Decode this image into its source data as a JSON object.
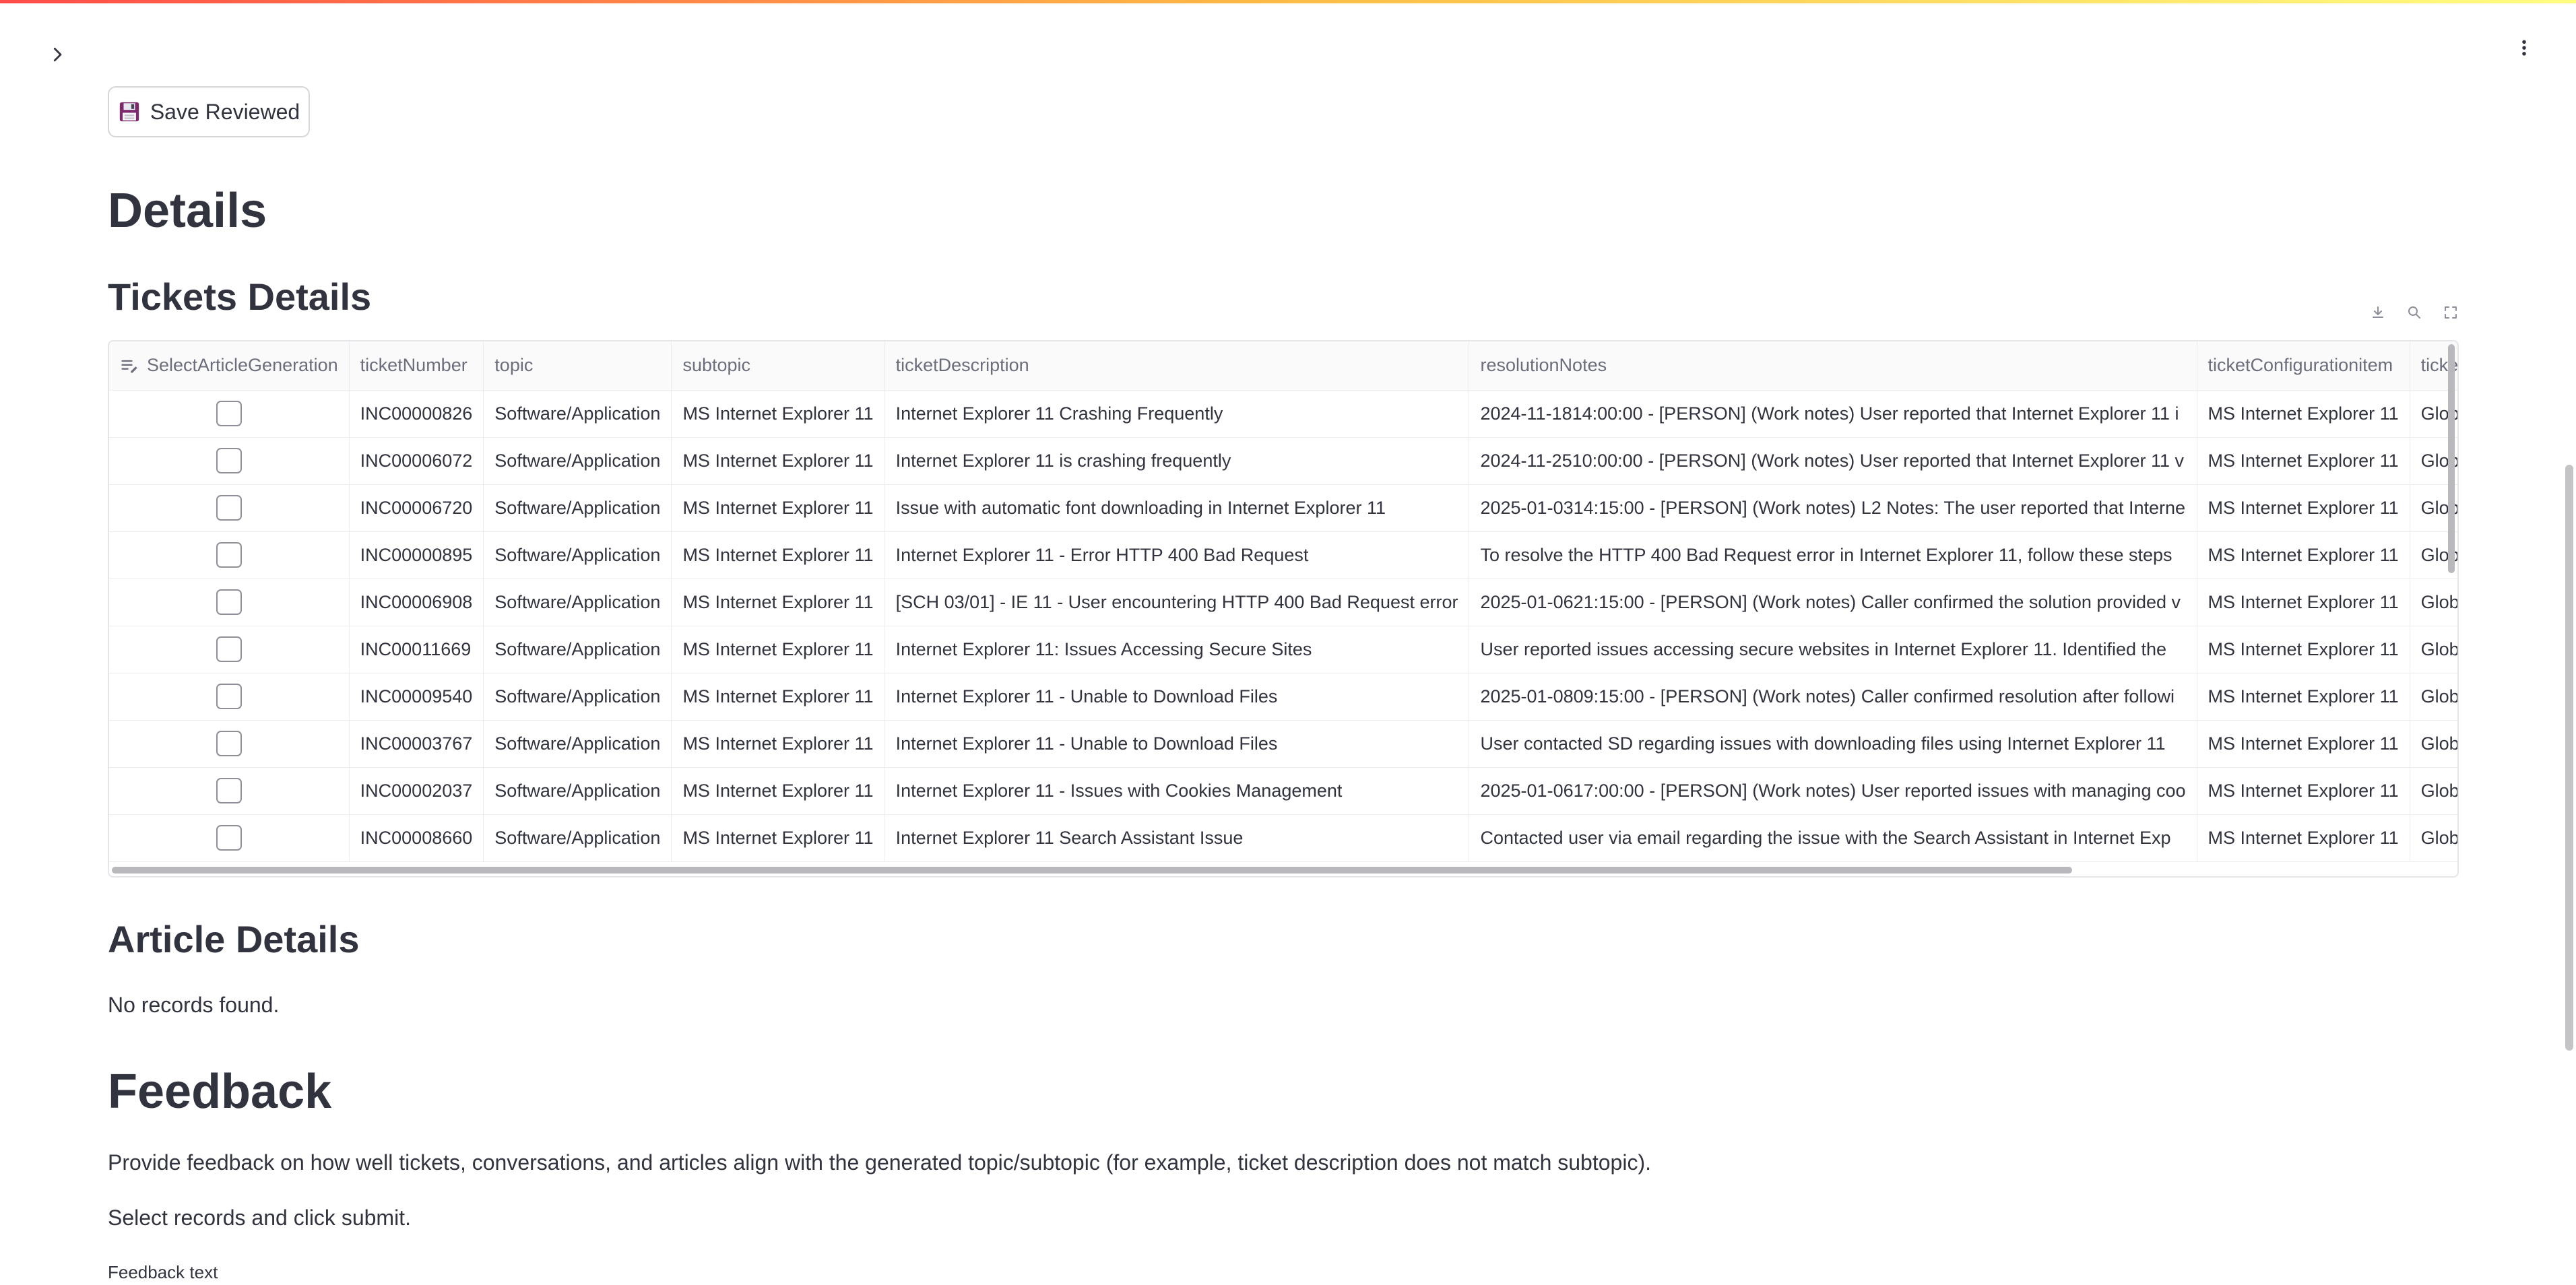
{
  "toolbar": {
    "save_label": "Save Reviewed"
  },
  "headings": {
    "details": "Details",
    "tickets_details": "Tickets Details",
    "article_details": "Article Details",
    "feedback": "Feedback"
  },
  "article": {
    "empty_message": "No records found."
  },
  "feedback": {
    "description": "Provide feedback on how well tickets, conversations, and articles align with the generated topic/subtopic (for example, ticket description does not match subtopic).",
    "instruction": "Select records and click submit.",
    "text_label": "Feedback text"
  },
  "grid": {
    "columns": [
      "SelectArticleGeneration",
      "ticketNumber",
      "topic",
      "subtopic",
      "ticketDescription",
      "resolutionNotes",
      "ticketConfigurationitem",
      "ticketAssignedTo"
    ],
    "rows": [
      {
        "selected": false,
        "ticketNumber": "INC00000826",
        "topic": "Software/Application",
        "subtopic": "MS Internet Explorer 11",
        "ticketDescription": "Internet Explorer 11 Crashing Frequently",
        "resolutionNotes": "2024-11-1814:00:00 - [PERSON] (Work notes) User reported that Internet Explorer 11 i",
        "ticketConfigurationitem": "MS Internet Explorer 11",
        "ticketAssignedTo": "Global.Propentia"
      },
      {
        "selected": false,
        "ticketNumber": "INC00006072",
        "topic": "Software/Application",
        "subtopic": "MS Internet Explorer 11",
        "ticketDescription": "Internet Explorer 11 is crashing frequently",
        "resolutionNotes": "2024-11-2510:00:00 - [PERSON] (Work notes) User reported that Internet Explorer 11 v",
        "ticketConfigurationitem": "MS Internet Explorer 11",
        "ticketAssignedTo": "Global.Propentia"
      },
      {
        "selected": false,
        "ticketNumber": "INC00006720",
        "topic": "Software/Application",
        "subtopic": "MS Internet Explorer 11",
        "ticketDescription": "Issue with automatic font downloading in Internet Explorer 11",
        "resolutionNotes": "2025-01-0314:15:00 - [PERSON] (Work notes) L2 Notes: The user reported that Interne",
        "ticketConfigurationitem": "MS Internet Explorer 11",
        "ticketAssignedTo": "Global.Propentia"
      },
      {
        "selected": false,
        "ticketNumber": "INC00000895",
        "topic": "Software/Application",
        "subtopic": "MS Internet Explorer 11",
        "ticketDescription": "Internet Explorer 11 - Error HTTP 400 Bad Request",
        "resolutionNotes": "To resolve the HTTP 400 Bad Request error in Internet Explorer 11, follow these steps",
        "ticketConfigurationitem": "MS Internet Explorer 11",
        "ticketAssignedTo": "Global.Propentia"
      },
      {
        "selected": false,
        "ticketNumber": "INC00006908",
        "topic": "Software/Application",
        "subtopic": "MS Internet Explorer 11",
        "ticketDescription": "[SCH 03/01] - IE 11 - User encountering HTTP 400 Bad Request error",
        "resolutionNotes": "2025-01-0621:15:00 - [PERSON] (Work notes) Caller confirmed the solution provided v",
        "ticketConfigurationitem": "MS Internet Explorer 11",
        "ticketAssignedTo": "Global.Propentia"
      },
      {
        "selected": false,
        "ticketNumber": "INC00011669",
        "topic": "Software/Application",
        "subtopic": "MS Internet Explorer 11",
        "ticketDescription": "Internet Explorer 11: Issues Accessing Secure Sites",
        "resolutionNotes": "User reported issues accessing secure websites in Internet Explorer 11. Identified the",
        "ticketConfigurationitem": "MS Internet Explorer 11",
        "ticketAssignedTo": "Global.Propentia"
      },
      {
        "selected": false,
        "ticketNumber": "INC00009540",
        "topic": "Software/Application",
        "subtopic": "MS Internet Explorer 11",
        "ticketDescription": "Internet Explorer 11 - Unable to Download Files",
        "resolutionNotes": "2025-01-0809:15:00 - [PERSON] (Work notes) Caller confirmed resolution after followi",
        "ticketConfigurationitem": "MS Internet Explorer 11",
        "ticketAssignedTo": "Global.Propentia"
      },
      {
        "selected": false,
        "ticketNumber": "INC00003767",
        "topic": "Software/Application",
        "subtopic": "MS Internet Explorer 11",
        "ticketDescription": "Internet Explorer 11 - Unable to Download Files",
        "resolutionNotes": "User contacted SD regarding issues with downloading files using Internet Explorer 11",
        "ticketConfigurationitem": "MS Internet Explorer 11",
        "ticketAssignedTo": "Global.Propentia"
      },
      {
        "selected": false,
        "ticketNumber": "INC00002037",
        "topic": "Software/Application",
        "subtopic": "MS Internet Explorer 11",
        "ticketDescription": "Internet Explorer 11 - Issues with Cookies Management",
        "resolutionNotes": "2025-01-0617:00:00 - [PERSON] (Work notes) User reported issues with managing coo",
        "ticketConfigurationitem": "MS Internet Explorer 11",
        "ticketAssignedTo": "Global.Propentia"
      },
      {
        "selected": false,
        "ticketNumber": "INC00008660",
        "topic": "Software/Application",
        "subtopic": "MS Internet Explorer 11",
        "ticketDescription": "Internet Explorer 11 Search Assistant Issue",
        "resolutionNotes": "Contacted user via email regarding the issue with the Search Assistant in Internet Exp",
        "ticketConfigurationitem": "MS Internet Explorer 11",
        "ticketAssignedTo": "Global.Propentia"
      }
    ]
  },
  "icons": {
    "sidebar_toggle": "chevron-right-icon",
    "main_menu": "kebab-menu-icon",
    "save": "floppy-disk-icon",
    "download": "download-icon",
    "search": "search-icon",
    "fullscreen": "fullscreen-icon",
    "edit_column": "edit-list-icon"
  },
  "colors": {
    "accent_gradient_start": "#ff4b4b",
    "accent_gradient_end": "#fffd80",
    "text": "#31333f",
    "header_text": "#6b6d7c"
  }
}
